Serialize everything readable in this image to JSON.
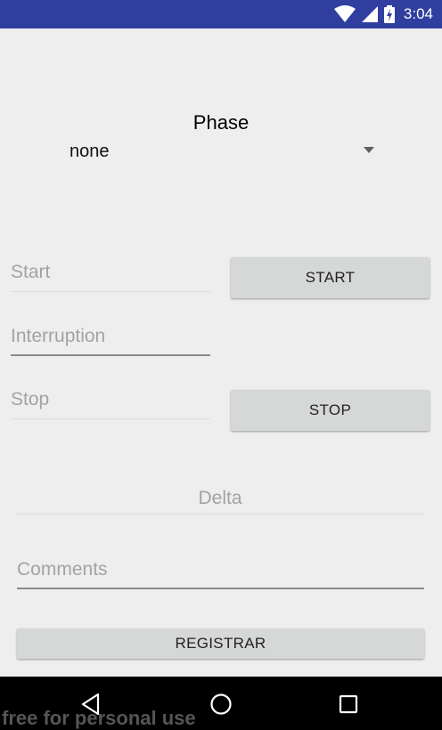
{
  "status_bar": {
    "time": "3:04",
    "icons": [
      "wifi-icon",
      "cell-signal-icon",
      "battery-charging-icon"
    ]
  },
  "form": {
    "phase_label": "Phase",
    "phase_spinner": {
      "selected": "none"
    },
    "start_field": {
      "placeholder": "Start"
    },
    "start_button": "START",
    "interruption_field": {
      "placeholder": "Interruption"
    },
    "stop_field": {
      "placeholder": "Stop"
    },
    "stop_button": "STOP",
    "delta_field": {
      "placeholder": "Delta"
    },
    "comments_field": {
      "placeholder": "Comments"
    },
    "register_button": "REGISTRAR"
  },
  "nav_bar": {
    "buttons": [
      "back-icon",
      "home-icon",
      "recents-icon"
    ]
  },
  "watermark": "free for personal use",
  "colors": {
    "status_bar": "#303f9f",
    "background": "#eeeeee",
    "button": "#d6d7d7",
    "hint": "#a3a3a3"
  }
}
